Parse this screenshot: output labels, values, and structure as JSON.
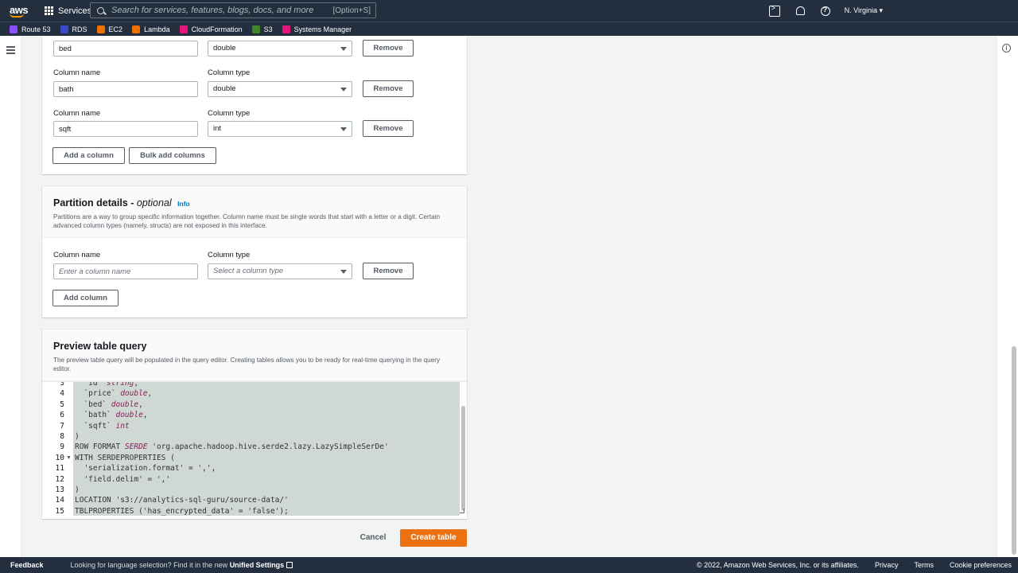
{
  "nav": {
    "logo": "aws",
    "services_label": "Services",
    "search_placeholder": "Search for services, features, blogs, docs, and more",
    "search_shortcut": "[Option+S]",
    "region": "N. Virginia ▾"
  },
  "favorites": [
    {
      "label": "Route 53",
      "color": "#8c4fff"
    },
    {
      "label": "RDS",
      "color": "#3b48cc"
    },
    {
      "label": "EC2",
      "color": "#ed7100"
    },
    {
      "label": "Lambda",
      "color": "#ed7100"
    },
    {
      "label": "CloudFormation",
      "color": "#e7157b"
    },
    {
      "label": "S3",
      "color": "#3f8624"
    },
    {
      "label": "Systems Manager",
      "color": "#e7157b"
    }
  ],
  "columns": {
    "rows": [
      {
        "name_label": "",
        "type_label": "",
        "name": "bed",
        "type": "double"
      },
      {
        "name_label": "Column name",
        "type_label": "Column type",
        "name": "bath",
        "type": "double"
      },
      {
        "name_label": "Column name",
        "type_label": "Column type",
        "name": "sqft",
        "type": "int"
      }
    ],
    "remove_label": "Remove",
    "add_column_label": "Add a column",
    "bulk_add_label": "Bulk add columns"
  },
  "partition": {
    "title": "Partition details -",
    "title_optional": "optional",
    "info": "Info",
    "description": "Partitions are a way to group specific information together. Column name must be single words that start with a letter or a digit. Certain advanced column types (namely, structs) are not exposed in this interface.",
    "name_label": "Column name",
    "type_label": "Column type",
    "name_placeholder": "Enter a column name",
    "type_placeholder": "Select a column type",
    "remove_label": "Remove",
    "add_label": "Add column"
  },
  "preview": {
    "title": "Preview table query",
    "description": "The preview table query will be populated in the query editor. Creating tables allows you to be ready for real-time querying in the query editor.",
    "lines": [
      {
        "n": "3",
        "pre": "  `id` ",
        "type": "string",
        "post": ","
      },
      {
        "n": "4",
        "pre": "  `price` ",
        "type": "double",
        "post": ","
      },
      {
        "n": "5",
        "pre": "  `bed` ",
        "type": "double",
        "post": ","
      },
      {
        "n": "6",
        "pre": "  `bath` ",
        "type": "double",
        "post": ","
      },
      {
        "n": "7",
        "pre": "  `sqft` ",
        "type": "int",
        "post": ""
      },
      {
        "n": "8",
        "pre": ")",
        "type": "",
        "post": ""
      },
      {
        "n": "9",
        "pre": "ROW FORMAT ",
        "type": "SERDE",
        "post": " 'org.apache.hadoop.hive.serde2.lazy.LazySimpleSerDe'"
      },
      {
        "n": "10",
        "pre": "WITH SERDEPROPERTIES (",
        "type": "",
        "post": ""
      },
      {
        "n": "11",
        "pre": "  'serialization.format' = ',',",
        "type": "",
        "post": ""
      },
      {
        "n": "12",
        "pre": "  'field.delim' = ','",
        "type": "",
        "post": ""
      },
      {
        "n": "13",
        "pre": ")",
        "type": "",
        "post": ""
      },
      {
        "n": "14",
        "pre": "LOCATION 's3://analytics-sql-guru/source-data/'",
        "type": "",
        "post": ""
      },
      {
        "n": "15",
        "pre": "TBLPROPERTIES ('has_encrypted_data' = 'false');",
        "type": "",
        "post": ""
      }
    ]
  },
  "actions": {
    "cancel": "Cancel",
    "create": "Create table"
  },
  "footer": {
    "feedback": "Feedback",
    "language_text": "Looking for language selection? Find it in the new",
    "unified_settings": "Unified Settings",
    "copyright": "© 2022, Amazon Web Services, Inc. or its affiliates.",
    "privacy": "Privacy",
    "terms": "Terms",
    "cookies": "Cookie preferences"
  }
}
